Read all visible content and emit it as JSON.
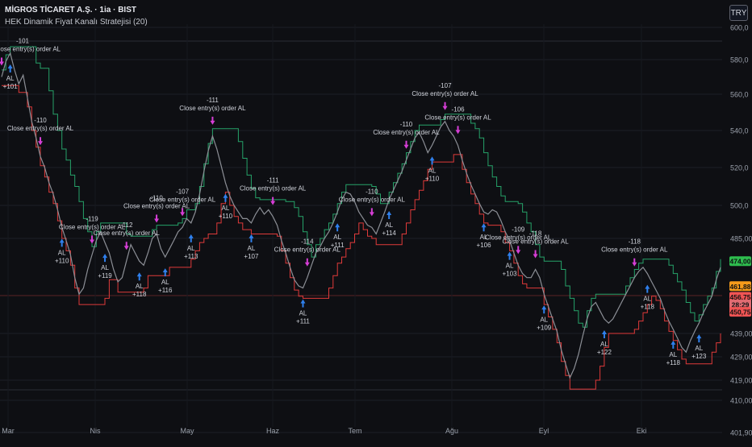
{
  "header": {
    "title": "MİGROS TİCARET A.Ş. · 1ia · BIST",
    "strategy": "HEK Dinamik Fiyat Kanalı Stratejisi (20)"
  },
  "currency": "TRY",
  "colors": {
    "background": "#0e0f13",
    "upper_channel": "#26a269",
    "lower_channel": "#e03a3a",
    "price": "#8c8f96",
    "long_marker": "#2f80ed",
    "close_marker": "#d63ed6",
    "axis_text": "#9aa0ab",
    "badge_green": "#2ebd4e",
    "badge_orange": "#f59b1b",
    "badge_red": "#f05454",
    "badge_pink": "#e06c73"
  },
  "chart_data": {
    "type": "line",
    "title": "MİGROS TİCARET A.Ş. · 1ia · BIST",
    "xlabel": "",
    "ylabel": "",
    "x_ticks": [
      "Mar",
      "Nis",
      "May",
      "Haz",
      "Tem",
      "Ağu",
      "Eyl",
      "Eki"
    ],
    "y_ticks": [
      "600,0",
      "580,0",
      "560,0",
      "540,0",
      "520,0",
      "500,0",
      "485,00",
      "439,00",
      "429,00",
      "419,00",
      "410,00",
      "401,90"
    ],
    "ylim": [
      401.9,
      600.0
    ],
    "grid": true,
    "legend": "none",
    "series": [
      {
        "name": "",
        "values": [
          570,
          579,
          584,
          574,
          566,
          571,
          558,
          545,
          536,
          526,
          520,
          512,
          506,
          498,
          490,
          484,
          477,
          466,
          458,
          461,
          470,
          477,
          484,
          488,
          483,
          478,
          470,
          464,
          466,
          474,
          482,
          478,
          474,
          472,
          478,
          485,
          487,
          480,
          476,
          480,
          484,
          488,
          490,
          494,
          492,
          497,
          506,
          518,
          529,
          537,
          530,
          521,
          512,
          505,
          500,
          497,
          494,
          494,
          492,
          496,
          499,
          496,
          498,
          495,
          491,
          484,
          478,
          471,
          465,
          462,
          461,
          466,
          472,
          478,
          481,
          485,
          488,
          492,
          497,
          503,
          507,
          506,
          502,
          497,
          494,
          491,
          490,
          487,
          492,
          497,
          503,
          508,
          513,
          518,
          524,
          530,
          536,
          539,
          534,
          528,
          532,
          537,
          542,
          545,
          540,
          537,
          532,
          524,
          517,
          511,
          506,
          501,
          497,
          496,
          498,
          497,
          493,
          488,
          484,
          478,
          472,
          468,
          466,
          466,
          470,
          466,
          458,
          452,
          446,
          440,
          432,
          426,
          420,
          424,
          430,
          438,
          446,
          452,
          454,
          450,
          446,
          444,
          446,
          450,
          454,
          458,
          462,
          466,
          469,
          471,
          468,
          464,
          460,
          456,
          450,
          445,
          441,
          437,
          433,
          431,
          436,
          440,
          444,
          449,
          453,
          457,
          465,
          471
        ]
      }
    ],
    "signals": [
      {
        "type": "AL",
        "label": "AL",
        "value": "+101"
      },
      {
        "type": "AL",
        "label": "AL",
        "value": "+110"
      },
      {
        "type": "AL",
        "label": "AL",
        "value": "+119"
      },
      {
        "type": "AL",
        "label": "AL",
        "value": "+118"
      },
      {
        "type": "AL",
        "label": "AL",
        "value": "+116"
      },
      {
        "type": "AL",
        "label": "AL",
        "value": "+113"
      },
      {
        "type": "AL",
        "label": "AL",
        "value": "+110"
      },
      {
        "type": "AL",
        "label": "AL",
        "value": "+107"
      },
      {
        "type": "AL",
        "label": "AL",
        "value": "+111"
      },
      {
        "type": "AL",
        "label": "AL",
        "value": "+111"
      },
      {
        "type": "AL",
        "label": "AL",
        "value": "+114"
      },
      {
        "type": "AL",
        "label": "AL",
        "value": "+110"
      },
      {
        "type": "AL",
        "label": "AL",
        "value": "+106"
      },
      {
        "type": "AL",
        "label": "AL",
        "value": "+103"
      },
      {
        "type": "AL",
        "label": "AL",
        "value": "+109"
      },
      {
        "type": "AL",
        "label": "AL",
        "value": "+122"
      },
      {
        "type": "AL",
        "label": "AL",
        "value": "+118"
      },
      {
        "type": "AL",
        "label": "AL",
        "value": "+118"
      },
      {
        "type": "AL",
        "label": "AL",
        "value": "+123"
      },
      {
        "type": "close",
        "label": "Close entry(s) order AL",
        "value": "-101"
      },
      {
        "type": "close",
        "label": "Close entry(s) order AL",
        "value": "-110"
      },
      {
        "type": "close",
        "label": "Close entry(s) order AL",
        "value": "-119"
      },
      {
        "type": "close",
        "label": "Close entry(s) order AL",
        "value": "-112"
      },
      {
        "type": "close",
        "label": "Close entry(s) order AL",
        "value": "-110"
      },
      {
        "type": "close",
        "label": "Close entry(s) order AL",
        "value": "-107"
      },
      {
        "type": "close",
        "label": "Close entry(s) order AL",
        "value": "-111"
      },
      {
        "type": "close",
        "label": "Close entry(s) order AL",
        "value": "-111"
      },
      {
        "type": "close",
        "label": "Close entry(s) order AL",
        "value": "-114"
      },
      {
        "type": "close",
        "label": "Close entry(s) order AL",
        "value": "-110"
      },
      {
        "type": "close",
        "label": "Close entry(s) order AL",
        "value": "-110"
      },
      {
        "type": "close",
        "label": "Close entry(s) order AL",
        "value": "-107"
      },
      {
        "type": "close",
        "label": "Close entry(s) order AL",
        "value": "-106"
      },
      {
        "type": "close",
        "label": "Close entry(s) order AL",
        "value": "-109"
      },
      {
        "type": "close",
        "label": "Close entry(s) order AL",
        "value": "-118"
      },
      {
        "type": "close",
        "label": "Close entry(s) order AL",
        "value": "-118"
      }
    ],
    "price_badges": [
      {
        "text": "474,00",
        "kind": "green",
        "value": 474.0
      },
      {
        "text": "461,88",
        "kind": "orange",
        "value": 461.88
      },
      {
        "text": "456,75",
        "kind": "red",
        "value": 456.75
      },
      {
        "text": "28:29",
        "kind": "pink",
        "value": 453.0
      },
      {
        "text": "450,75",
        "kind": "red",
        "value": 449.5
      }
    ]
  }
}
